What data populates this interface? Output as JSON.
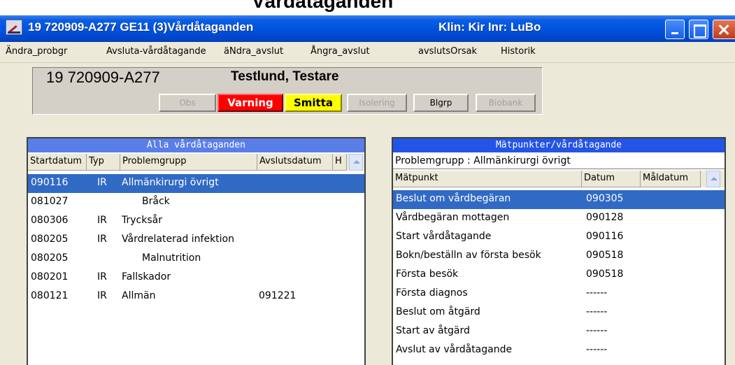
{
  "top_caption": "Vårdataganden",
  "window": {
    "title": "19 720909-A277   GE11 (3)Vårdåtaganden",
    "title_right": "Klin: Kir  Inr: LuBo"
  },
  "menu": [
    "Ändra_probgr",
    "Avsluta-vårdåtagande",
    "äNdra_avslut",
    "Ångra_avslut",
    "avslutsOrsak",
    "Historik"
  ],
  "patient": {
    "id": "19 720909-A277",
    "name": "Testlund, Testare"
  },
  "flags": {
    "obs": "Obs",
    "varning": "Varning",
    "smitta": "Smitta",
    "isolering": "Isolering",
    "blgrp": "Blgrp",
    "biobank": "Biobank"
  },
  "colors": {
    "title_blue": "#0053e0",
    "selection": "#316ac5",
    "varning": "#ff0000",
    "smitta": "#ffff00"
  },
  "left_pane": {
    "title": "Alla vårdåtaganden",
    "columns": [
      "Startdatum",
      "Typ",
      "Problemgrupp",
      "Avslutsdatum",
      "H"
    ],
    "rows": [
      {
        "start": "090116",
        "typ": "IR",
        "grupp": "Allmänkirurgi övrigt",
        "avslut": ""
      },
      {
        "start": "081027",
        "typ": "",
        "grupp": "Bråck",
        "avslut": ""
      },
      {
        "start": "080306",
        "typ": "IR",
        "grupp": "Trycksår",
        "avslut": ""
      },
      {
        "start": "080205",
        "typ": "IR",
        "grupp": "Vårdrelaterad infektion",
        "avslut": ""
      },
      {
        "start": "080205",
        "typ": "",
        "grupp": "Malnutrition",
        "avslut": ""
      },
      {
        "start": "080201",
        "typ": "IR",
        "grupp": "Fallskador",
        "avslut": ""
      },
      {
        "start": "080121",
        "typ": "IR",
        "grupp": "Allmän",
        "avslut": "091221"
      }
    ]
  },
  "right_pane": {
    "title": "Mätpunkter/vårdåtagande",
    "problemgrupp": "Problemgrupp :  Allmänkirurgi övrigt",
    "columns": [
      "Mätpunkt",
      "Datum",
      "Måldatum"
    ],
    "rows": [
      {
        "punkt": "Beslut om vårdbegäran",
        "datum": "090305"
      },
      {
        "punkt": "Vårdbegäran mottagen",
        "datum": "090128"
      },
      {
        "punkt": "Start vårdåtagande",
        "datum": "090116"
      },
      {
        "punkt": "Bokn/beställn av första besök",
        "datum": "090518"
      },
      {
        "punkt": "Första besök",
        "datum": "090518"
      },
      {
        "punkt": "Första diagnos",
        "datum": "------"
      },
      {
        "punkt": "Beslut om åtgärd",
        "datum": "------"
      },
      {
        "punkt": "Start av åtgärd",
        "datum": "------"
      },
      {
        "punkt": "Avslut av vårdåtagande",
        "datum": "------"
      }
    ]
  }
}
